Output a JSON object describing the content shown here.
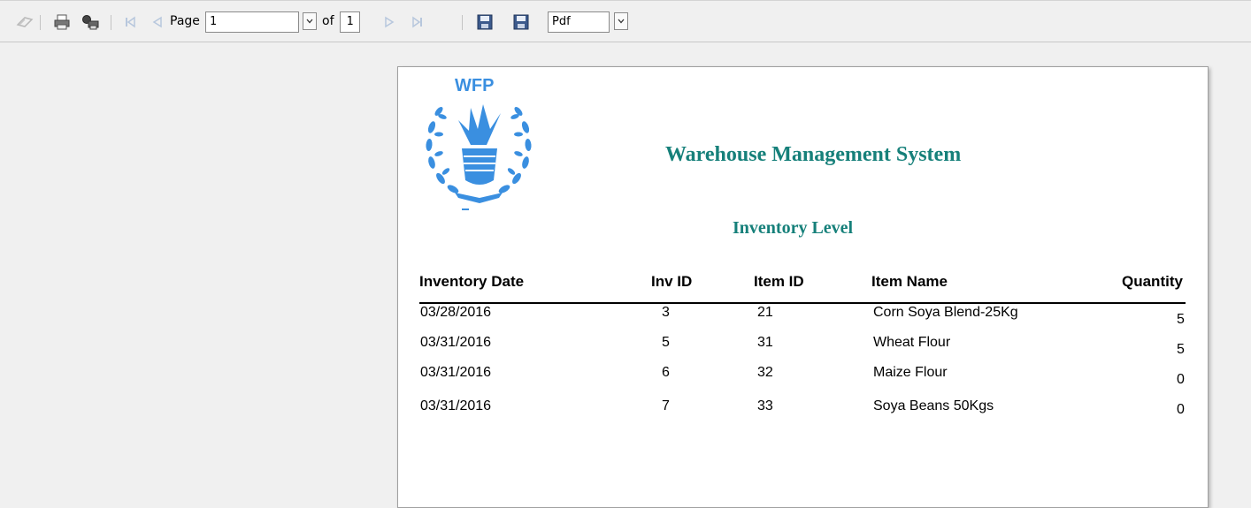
{
  "toolbar": {
    "page_label": "Page",
    "page_value": "1",
    "of_label": "of",
    "total_pages": "1",
    "format_value": "Pdf",
    "icons": [
      "refresh-icon",
      "print-icon",
      "print-preview-icon",
      "first-page-icon",
      "prev-page-icon",
      "next-page-icon",
      "last-page-icon",
      "save-icon",
      "export-icon"
    ]
  },
  "report": {
    "logo_text": "WFP",
    "title": "Warehouse Management System",
    "subtitle": "Inventory Level",
    "columns": [
      "Inventory Date",
      "Inv ID",
      "Item ID",
      "Item Name",
      "Quantity"
    ],
    "rows": [
      [
        "03/28/2016",
        "3",
        "21",
        "Corn Soya Blend-25Kg",
        "5"
      ],
      [
        "03/31/2016",
        "5",
        "31",
        "Wheat Flour",
        "5"
      ],
      [
        "03/31/2016",
        "6",
        "32",
        "Maize Flour",
        "0"
      ],
      [
        "03/31/2016",
        "7",
        "33",
        "Soya Beans 50Kgs",
        "0"
      ]
    ]
  },
  "colors": {
    "title": "#16807a",
    "logo": "#3a8fe0"
  }
}
